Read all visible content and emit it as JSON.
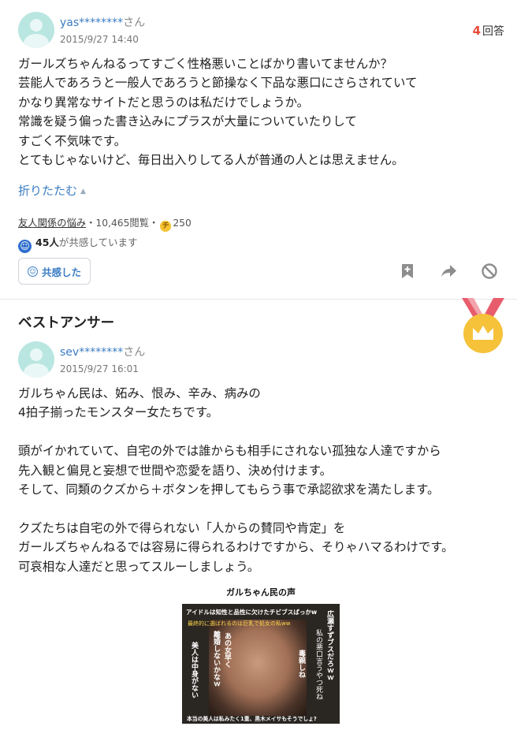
{
  "question": {
    "user_name": "yas********",
    "user_suffix": "さん",
    "date": "2015/9/27 14:40",
    "answers_count": "4",
    "answers_label": "回答",
    "body": [
      "ガールズちゃんねるってすごく性格悪いことばかり書いてませんか？",
      "芸能人であろうと一般人であろうと節操なく下品な悪口にさらされていて",
      "かなり異常なサイトだと思うのは私だけでしょうか。",
      "常識を疑う偏った書き込みにプラスが大量についていたりして",
      "すごく不気味です。",
      "とてもじゃないけど、毎日出入りしてる人が普通の人とは思えません。"
    ],
    "fold_label": "折りたたむ",
    "category": "友人関係の悩み",
    "views": "・10,465閲覧・",
    "coin_symbol": "チ",
    "coins": "250",
    "empathy_count": "45人",
    "empathy_text": "が共感しています",
    "empathy_button": "共感した"
  },
  "best_answer": {
    "heading": "ベストアンサー",
    "user_name": "sev********",
    "user_suffix": "さん",
    "date": "2015/9/27 16:01",
    "body": [
      "ガルちゃん民は、妬み、恨み、辛み、病みの",
      "4拍子揃ったモンスター女たちです。",
      "",
      "頭がイかれていて、自宅の外では誰からも相手にされない孤独な人達ですから",
      "先入観と偏見と妄想で世間や恋愛を語り、決め付けます。",
      "そして、同類のクズから＋ボタンを押してもらう事で承認欲求を満たします。",
      "",
      "クズたちは自宅の外で得られない「人からの賛同や肯定」を",
      "ガールズちゃんねるでは容易に得られるわけですから、そりゃハマるわけです。",
      "可哀相な人達だと思ってスルーしましょう。"
    ],
    "image": {
      "title": "ガルちゃん民の声",
      "caption_top": "アイドルは知性と品性に欠けたチビブスばっかw",
      "caption_sub": "最終的に選ばれるのは巨乳で処女の私ww",
      "col_right": "広瀬すずブスだろｗｗ",
      "col_right2": "私の悪口言うやつ死ね",
      "col_mid": "毒親しね",
      "col_mid2": "あの女早く",
      "col_mid3": "離婚しないかなｗ",
      "col_left": "美人は中身がない",
      "caption_bottom": "本当の美人は私みたく1重、黒木メイサもそうでしょ?"
    }
  },
  "colors": {
    "link": "#3a7cc4",
    "answers_num": "#e64c3c",
    "medal_gold": "#f5c23a",
    "ribbon": "#e85d6c"
  },
  "icons": [
    "avatar",
    "chevron-up-icon",
    "coin-icon",
    "smile-icon",
    "bookmark-icon",
    "share-arrow-icon",
    "block-icon",
    "crown-medal-icon"
  ]
}
